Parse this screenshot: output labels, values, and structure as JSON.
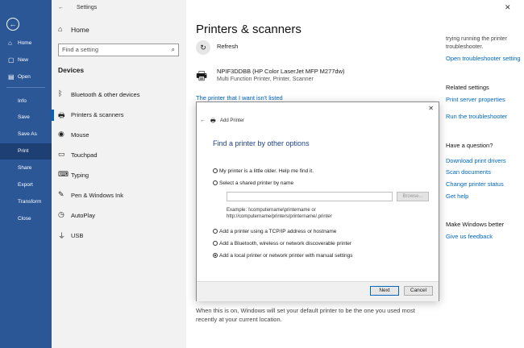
{
  "rail": {
    "items": [
      {
        "icon": "⌂",
        "label": "Home"
      },
      {
        "icon": "▢",
        "label": "New"
      },
      {
        "icon": "▤",
        "label": "Open"
      },
      {
        "icon": "",
        "label": "Info"
      },
      {
        "icon": "",
        "label": "Save"
      },
      {
        "icon": "",
        "label": "Save As"
      },
      {
        "icon": "",
        "label": "Print"
      },
      {
        "icon": "",
        "label": "Share"
      },
      {
        "icon": "",
        "label": "Export"
      },
      {
        "icon": "",
        "label": "Transform"
      },
      {
        "icon": "",
        "label": "Close"
      }
    ],
    "active_label": "Print",
    "color": "#2b5797"
  },
  "settings": {
    "window_title": "Settings",
    "home_label": "Home",
    "search_placeholder": "Find a setting",
    "section": "Devices",
    "items": [
      {
        "icon": "bluetooth-icon",
        "label": "Bluetooth & other devices"
      },
      {
        "icon": "printer-icon",
        "label": "Printers & scanners"
      },
      {
        "icon": "mouse-icon",
        "label": "Mouse"
      },
      {
        "icon": "touchpad-icon",
        "label": "Touchpad"
      },
      {
        "icon": "keyboard-icon",
        "label": "Typing"
      },
      {
        "icon": "pen-icon",
        "label": "Pen & Windows Ink"
      },
      {
        "icon": "autoplay-icon",
        "label": "AutoPlay"
      },
      {
        "icon": "usb-icon",
        "label": "USB"
      }
    ],
    "selected": "Printers & scanners"
  },
  "main": {
    "title": "Printers & scanners",
    "refresh_label": "Refresh",
    "printer_name": "NPIF3DDBB (HP Color LaserJet MFP M277dw)",
    "printer_desc": "Multi Function Printer, Printer, Scanner",
    "not_listed_link": "The printer that I want isn't listed",
    "footer_text": "When this is on, Windows will set your default printer to be the one you used most recently at your current location."
  },
  "right": {
    "top_text_1": "trying running the printer",
    "top_text_2": "troubleshooter.",
    "open_troubleshooter": "Open troubleshooter setting",
    "related_heading": "Related settings",
    "related_links": [
      "Print server properties",
      "Run the troubleshooter"
    ],
    "question_heading": "Have a question?",
    "question_links": [
      "Download print drivers",
      "Scan documents",
      "Change printer status",
      "Get help"
    ],
    "better_heading": "Make Windows better",
    "feedback_link": "Give us feedback"
  },
  "dialog": {
    "header": "Add Printer",
    "title": "Find a printer by other options",
    "options": [
      "My printer is a little older. Help me find it.",
      "Select a shared printer by name",
      "Add a printer using a TCP/IP address or hostname",
      "Add a Bluetooth, wireless or network discoverable printer",
      "Add a local printer or network printer with manual settings"
    ],
    "selected_option": 4,
    "browse_label": "Browse...",
    "example_line1": "Example: \\\\computername\\printername or",
    "example_line2": "http://computername/printers/printername/.printer",
    "next_label": "Next",
    "cancel_label": "Cancel"
  }
}
